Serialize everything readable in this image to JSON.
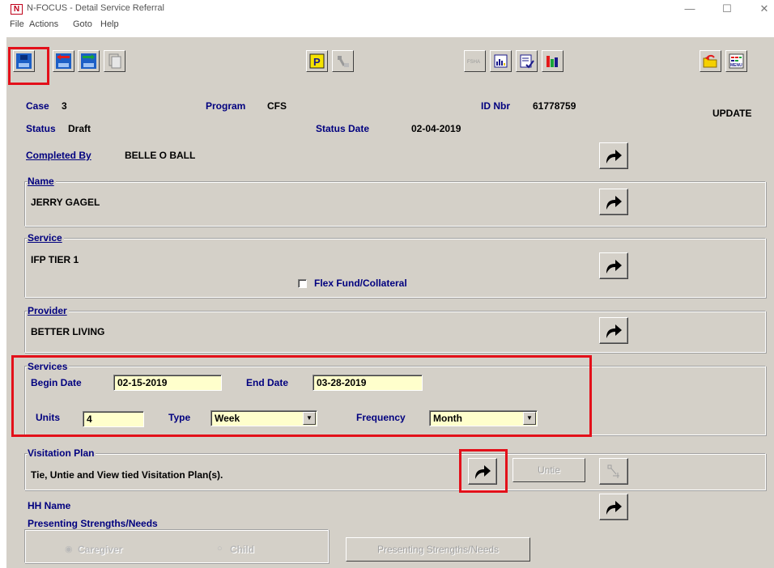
{
  "window": {
    "app_icon": "N",
    "title": "N-FOCUS - Detail Service Referral",
    "minimize": "—",
    "maximize": "☐",
    "close": "✕"
  },
  "menu": [
    "File",
    "Actions",
    "Goto",
    "Help"
  ],
  "toolbar": {
    "icons": [
      "save-icon",
      "swap-icon",
      "next-icon",
      "copy-icon",
      "p-icon",
      "tools-icon",
      "fsha-icon",
      "report-icon",
      "checklist-icon",
      "chart-icon",
      "open-folder-icon",
      "menu-icon"
    ],
    "fsha_label": "FSHA",
    "menu_label": "MENU"
  },
  "header": {
    "case_label": "Case",
    "case_value": "3",
    "program_label": "Program",
    "program_value": "CFS",
    "id_label": "ID Nbr",
    "id_value": "61778759",
    "mode": "UPDATE",
    "status_label": "Status",
    "status_value": "Draft",
    "status_date_label": "Status Date",
    "status_date_value": "02-04-2019",
    "completed_by_label": "Completed By",
    "completed_by_value": "BELLE O BALL"
  },
  "name": {
    "label": "Name",
    "value": "JERRY GAGEL"
  },
  "service": {
    "label": "Service",
    "value": "IFP TIER 1",
    "flex_label": "Flex Fund/Collateral"
  },
  "provider": {
    "label": "Provider",
    "value": "BETTER LIVING"
  },
  "services": {
    "label": "Services",
    "begin_label": "Begin Date",
    "begin_value": "02-15-2019",
    "end_label": "End Date",
    "end_value": "03-28-2019",
    "units_label": "Units",
    "units_value": "4",
    "type_label": "Type",
    "type_value": "Week",
    "frequency_label": "Frequency",
    "frequency_value": "Month"
  },
  "visitation": {
    "label": "Visitation Plan",
    "text": "Tie, Untie and View tied Visitation Plan(s).",
    "untie_label": "Untie"
  },
  "hh": {
    "label": "HH Name"
  },
  "presenting": {
    "label": "Presenting Strengths/Needs",
    "radio1": "Caregiver",
    "radio2": "Child",
    "button_label": "Presenting Strengths/Needs"
  },
  "colors": {
    "label_blue": "#00007f",
    "field_yellow": "#ffffcc",
    "panel_gray": "#d4d0c8",
    "highlight_red": "#e3101a"
  }
}
